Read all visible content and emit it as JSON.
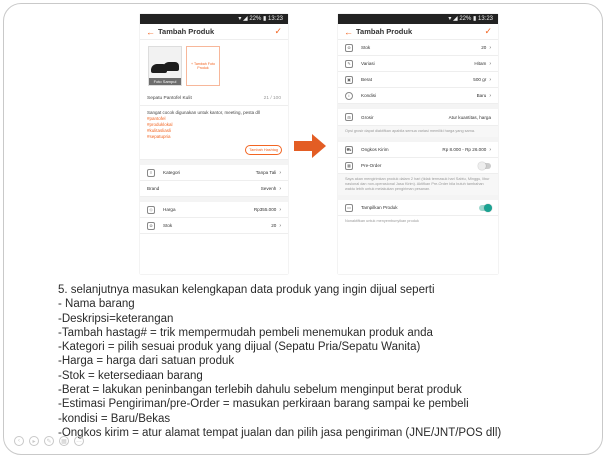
{
  "left_phone": {
    "status": "▾ ◢ 22% ▮ 13:23",
    "title": "Tambah Produk",
    "photo_caption": "Foto Sampul",
    "add_photo": "+ Tambah Foto Produk",
    "product_name": "Sepatu Pantofel Kulit",
    "name_count": "21 / 100",
    "description": "Sangat cocok digunakan untuk kantor, meeting, pesta dll",
    "hashtags": [
      "#pantofel",
      "#produklokal",
      "#kulitasliasli",
      "#sepatupria"
    ],
    "hashtag_button": "Tambah Hashtag",
    "rows": [
      {
        "label": "Kategori",
        "value": "Tanpa Tali"
      },
      {
        "label": "Brand",
        "value": "Sevenh"
      },
      {
        "label": "Harga",
        "value": "Rp355.000"
      },
      {
        "label": "Stok",
        "value": "20"
      }
    ]
  },
  "right_phone": {
    "status": "▾ ◢ 22% ▮ 13:23",
    "title": "Tambah Produk",
    "rows_top": [
      {
        "label": "Stok",
        "value": "20"
      },
      {
        "label": "Variasi",
        "value": "Hitam"
      },
      {
        "label": "Berat",
        "value": "500 gr"
      },
      {
        "label": "Kondisi",
        "value": "Baru"
      }
    ],
    "grosir": {
      "label": "Grosir",
      "value": "Atur kuantitas, harga"
    },
    "grosir_note": "Opsi grosir dapat diaktifkan apabila semua variasi memiliki harga yang sama.",
    "ongkir": {
      "label": "Ongkos Kirim",
      "value": "Rp 8.000 - Rp 26.000"
    },
    "preorder_label": "Pre-Order",
    "preorder_note": "Saya akan mengirimkan produk dalam 2 hari (tidak termasuk hari Sabtu, Minggu, libur nasional dan non-operasional Jasa Kirim). Aktifkan Pre-Order bila butuh tambahan waktu lebih untuk melakukan pengiriman pesanan.",
    "show_label": "Tampilkan Produk",
    "show_note": "Nonaktifkan untuk menyembunyikan produk"
  },
  "text_lines": [
    "5. selanjutnya masukan kelengkapan data produk yang ingin dijual seperti",
    "- Nama barang",
    "-Deskripsi=keterangan",
    "-Tambah hastag# = trik mempermudah pembeli menemukan produk anda",
    "-Kategori = pilih sesuai produk yang dijual (Sepatu Pria/Sepatu Wanita)",
    "-Harga = harga dari satuan produk",
    "-Stok = ketersediaan barang",
    "-Berat = lakukan peninbangan terlebih dahulu sebelum menginput berat produk",
    "-Estimasi Pengiriman/pre-Order = masukan perkiraan barang sampai ke pembeli",
    "-kondisi = Baru/Bekas",
    "-Ongkos kirim = atur alamat tempat jualan dan pilih jasa pengiriman (JNE/JNT/POS dll)"
  ],
  "colors": {
    "accent": "#f26522",
    "arrow": "#e35d24",
    "toggle_on": "#1aa392"
  }
}
